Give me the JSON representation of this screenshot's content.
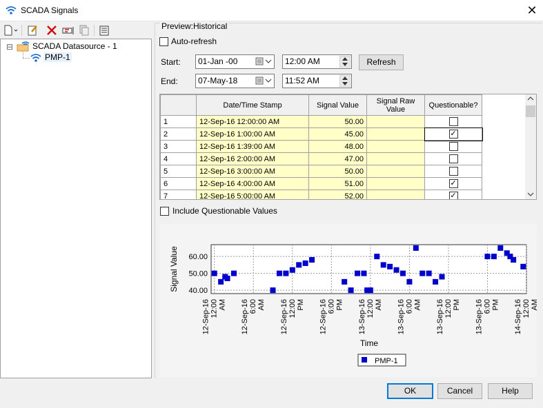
{
  "window": {
    "title": "SCADA Signals",
    "close_glyph": "✕"
  },
  "toolbar": {
    "icons": [
      "new-doc-icon",
      "edit-icon",
      "delete-icon",
      "rename-icon",
      "copy-icon",
      "properties-icon"
    ]
  },
  "tree": {
    "root_toggle": "⊟",
    "root_label": "SCADA Datasource - 1",
    "child_label": "PMP-1"
  },
  "preview": {
    "label": "Preview:",
    "mode": "Historical",
    "auto_refresh_label": "Auto-refresh",
    "auto_refresh_checked": false,
    "start_label": "Start:",
    "start_date": "01-Jan -00",
    "start_time": "12:00 AM",
    "end_label": "End:",
    "end_date": "07-May-18",
    "end_time": "11:52 AM",
    "refresh_label": "Refresh"
  },
  "table": {
    "columns": [
      "",
      "Date/Time Stamp",
      "Signal Value",
      "Signal Raw Value",
      "Questionable?"
    ],
    "rows": [
      {
        "n": "1",
        "ts": "12-Sep-16 12:00:00 AM",
        "value": "50.00",
        "raw": "",
        "q": false
      },
      {
        "n": "2",
        "ts": "12-Sep-16 1:00:00 AM",
        "value": "45.00",
        "raw": "",
        "q": true
      },
      {
        "n": "3",
        "ts": "12-Sep-16 1:39:00 AM",
        "value": "48.00",
        "raw": "",
        "q": false
      },
      {
        "n": "4",
        "ts": "12-Sep-16 2:00:00 AM",
        "value": "47.00",
        "raw": "",
        "q": false
      },
      {
        "n": "5",
        "ts": "12-Sep-16 3:00:00 AM",
        "value": "50.00",
        "raw": "",
        "q": false
      },
      {
        "n": "6",
        "ts": "12-Sep-16 4:00:00 AM",
        "value": "51.00",
        "raw": "",
        "q": true
      },
      {
        "n": "7",
        "ts": "12-Sep-16 5:00:00 AM",
        "value": "52.00",
        "raw": "",
        "q": true
      }
    ]
  },
  "include_questionable_label": "Include Questionable Values",
  "include_questionable_checked": false,
  "chart_data": {
    "type": "scatter",
    "xlabel": "Time",
    "ylabel": "Signal Value",
    "ylim": [
      38,
      67
    ],
    "yticks": [
      "40.00",
      "50.00",
      "60.00"
    ],
    "ytick_values": [
      40,
      50,
      60
    ],
    "xlim": [
      -0.5,
      48
    ],
    "xtick_hours": [
      0,
      6,
      12,
      18,
      24,
      30,
      36,
      42,
      48
    ],
    "xtick_labels": [
      [
        "12-Sep-16",
        "12:00",
        "AM"
      ],
      [
        "12-Sep-16",
        "6:00",
        "AM"
      ],
      [
        "12-Sep-16",
        "12:00",
        "PM"
      ],
      [
        "12-Sep-16",
        "6:00",
        "PM"
      ],
      [
        "13-Sep-16",
        "12:00",
        "AM"
      ],
      [
        "13-Sep-16",
        "6:00",
        "AM"
      ],
      [
        "13-Sep-16",
        "12:00",
        "PM"
      ],
      [
        "13-Sep-16",
        "6:00",
        "PM"
      ],
      [
        "14-Sep-16",
        "12:00",
        "AM"
      ]
    ],
    "grid": true,
    "legend": "bottom",
    "marker_color": "#0000cc",
    "series": [
      {
        "name": "PMP-1",
        "x": [
          0,
          1,
          1.65,
          2,
          3,
          9,
          10,
          11,
          12,
          13,
          14,
          15,
          20,
          21,
          22,
          23,
          23.5,
          24,
          25,
          26,
          27,
          28,
          29,
          30,
          31,
          32,
          33,
          34,
          35,
          42,
          43,
          44,
          45,
          45.5,
          46,
          47.5
        ],
        "y": [
          50,
          45,
          48,
          47,
          50,
          40,
          50,
          50,
          52,
          55,
          56,
          58,
          45,
          40,
          50,
          50,
          40,
          40,
          60,
          55,
          54,
          52,
          50,
          45,
          65,
          50,
          50,
          45,
          48,
          60,
          60,
          65,
          62,
          60,
          58,
          54
        ]
      }
    ]
  },
  "buttons": {
    "ok": "OK",
    "cancel": "Cancel",
    "help": "Help"
  }
}
